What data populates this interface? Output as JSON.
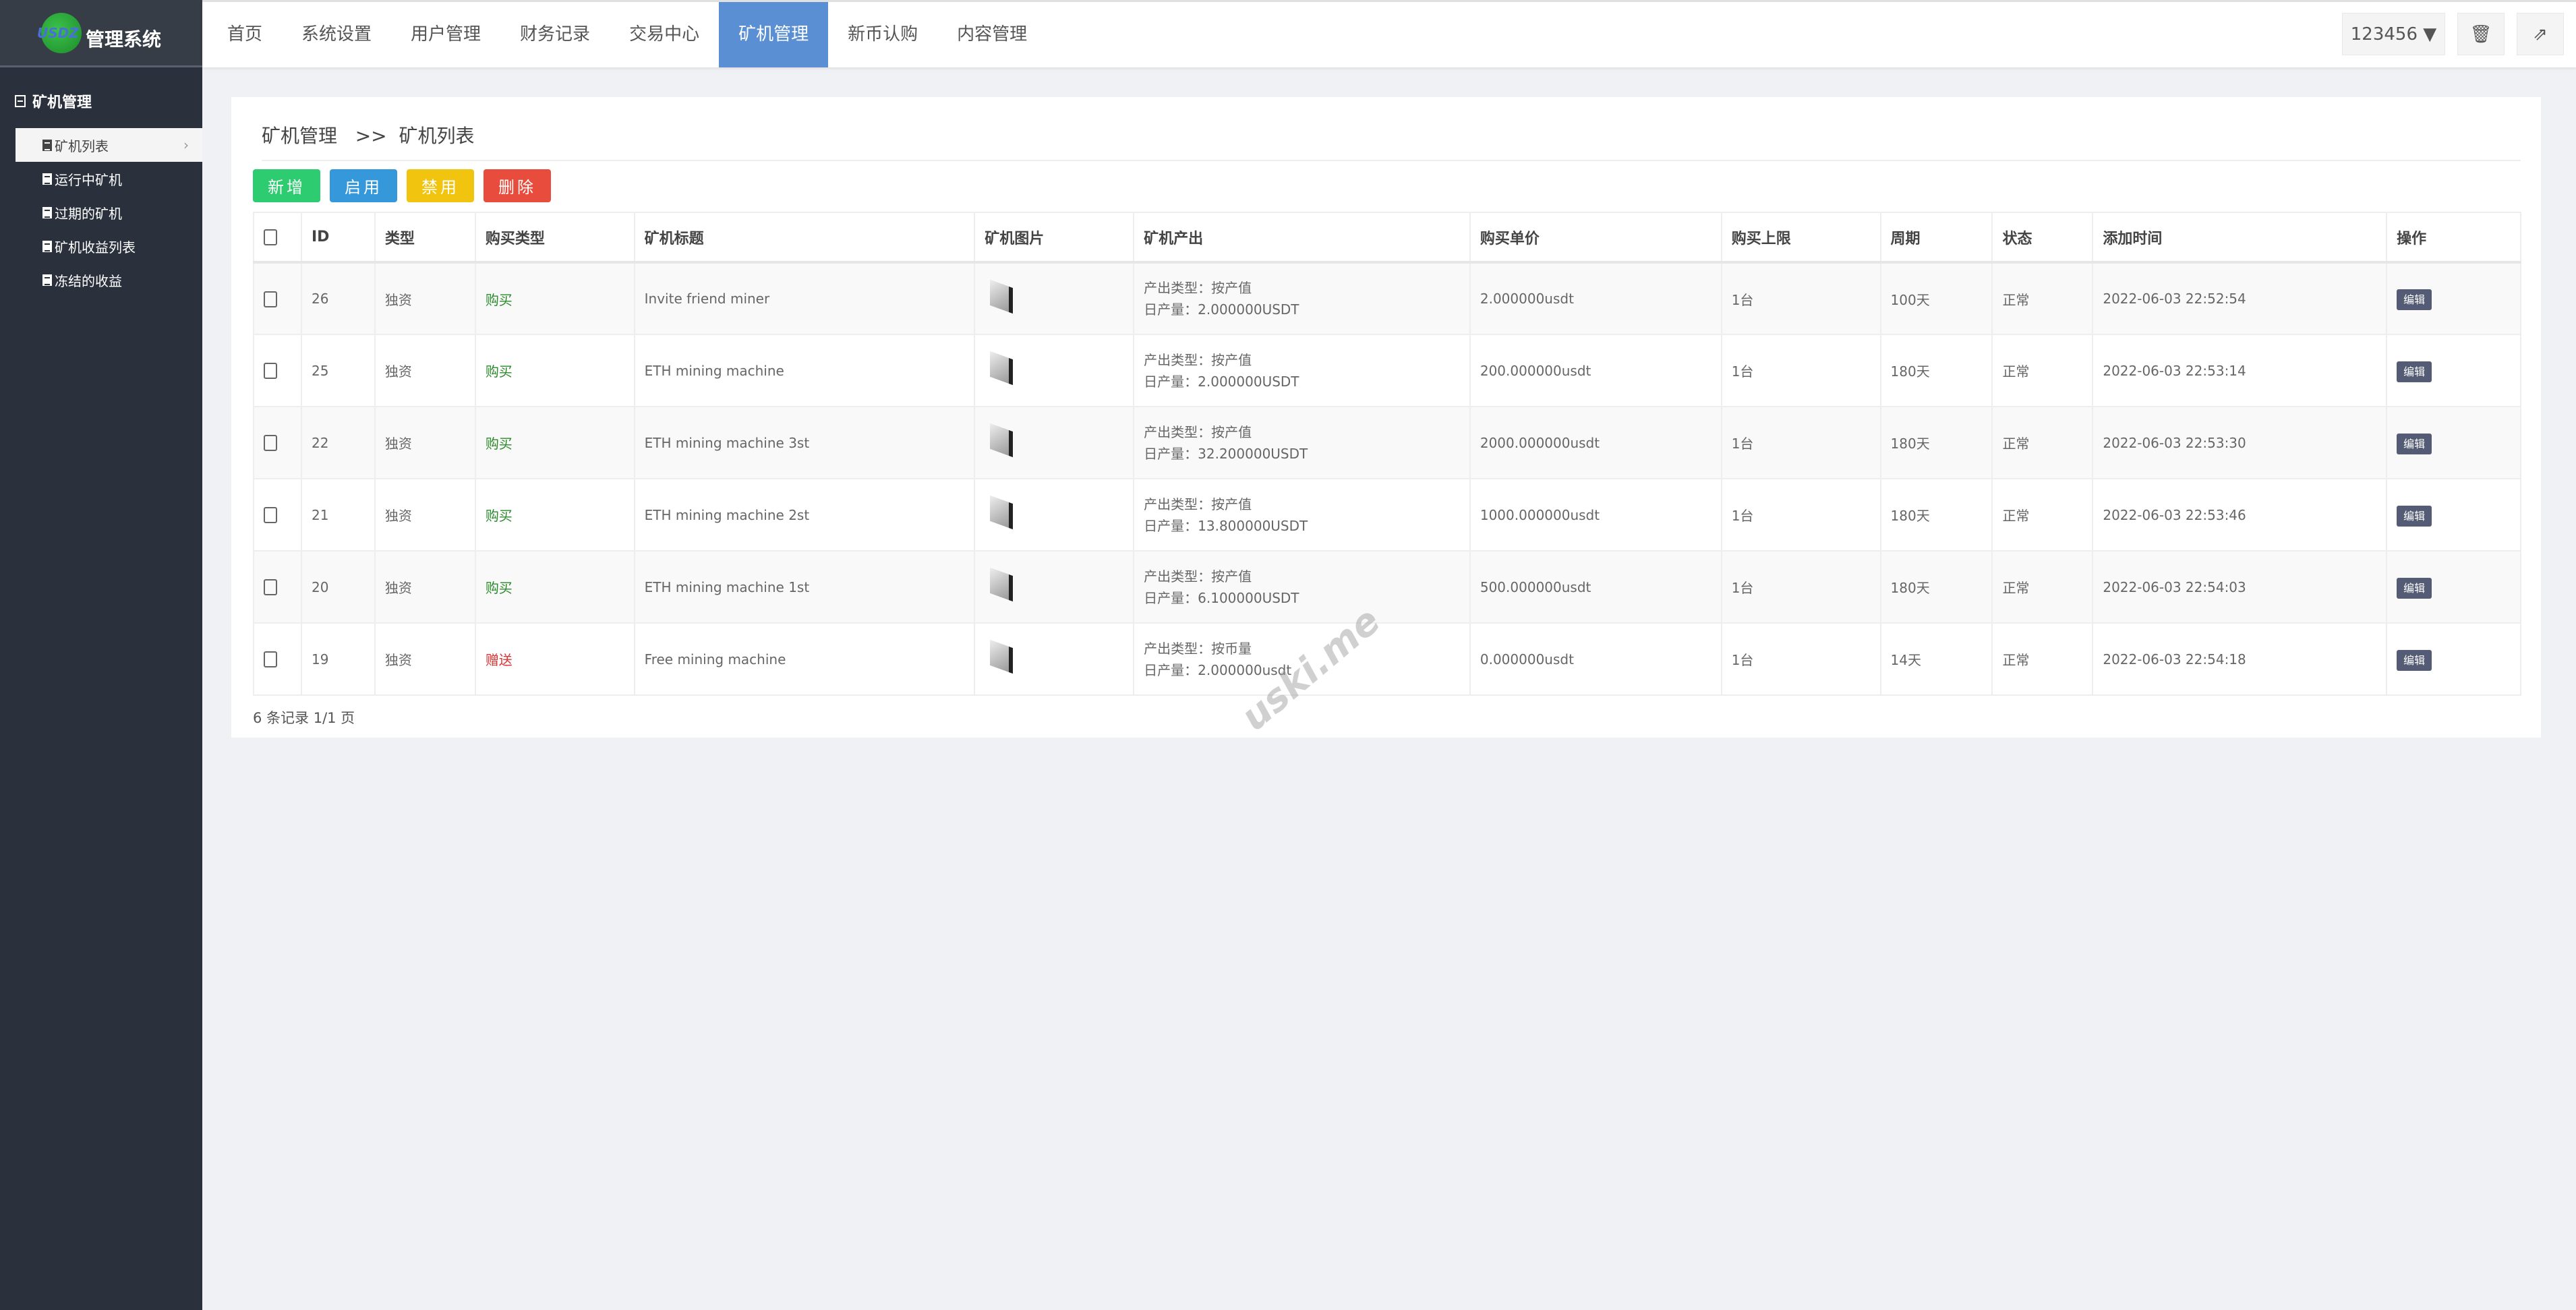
{
  "app": {
    "logo_text": "USDZ",
    "title": "管理系统"
  },
  "nav": {
    "items": [
      "首页",
      "系统设置",
      "用户管理",
      "财务记录",
      "交易中心",
      "矿机管理",
      "新币认购",
      "内容管理"
    ],
    "active": 5
  },
  "topright": {
    "user": "123456",
    "trash_icon": "trash-icon",
    "logout_icon": "share-exit-icon"
  },
  "sidebar": {
    "group": "矿机管理",
    "items": [
      "矿机列表",
      "运行中矿机",
      "过期的矿机",
      "矿机收益列表",
      "冻结的收益"
    ],
    "active": 0
  },
  "breadcrumb": {
    "parent": "矿机管理",
    "sep": ">>",
    "current": "矿机列表"
  },
  "actions": [
    {
      "label": "新增",
      "color": "#2ecc71"
    },
    {
      "label": "启用",
      "color": "#3498db"
    },
    {
      "label": "禁用",
      "color": "#f1c40f"
    },
    {
      "label": "删除",
      "color": "#e74c3c"
    }
  ],
  "table": {
    "columns": [
      "ID",
      "类型",
      "购买类型",
      "矿机标题",
      "矿机图片",
      "矿机产出",
      "购买单价",
      "购买上限",
      "周期",
      "状态",
      "添加时间",
      "操作"
    ],
    "rows": [
      {
        "id": "26",
        "type": "独资",
        "buy": "购买",
        "title": "Invite friend miner",
        "out1": "产出类型：按产值",
        "out2": "日产量：2.000000USDT",
        "price": "2.000000usdt",
        "limit": "1台",
        "period": "100天",
        "status": "正常",
        "time": "2022-06-03 22:52:54",
        "op": "编辑"
      },
      {
        "id": "25",
        "type": "独资",
        "buy": "购买",
        "title": "ETH mining machine",
        "out1": "产出类型：按产值",
        "out2": "日产量：2.000000USDT",
        "price": "200.000000usdt",
        "limit": "1台",
        "period": "180天",
        "status": "正常",
        "time": "2022-06-03 22:53:14",
        "op": "编辑"
      },
      {
        "id": "22",
        "type": "独资",
        "buy": "购买",
        "title": "ETH mining machine 3st",
        "out1": "产出类型：按产值",
        "out2": "日产量：32.200000USDT",
        "price": "2000.000000usdt",
        "limit": "1台",
        "period": "180天",
        "status": "正常",
        "time": "2022-06-03 22:53:30",
        "op": "编辑"
      },
      {
        "id": "21",
        "type": "独资",
        "buy": "购买",
        "title": "ETH mining machine 2st",
        "out1": "产出类型：按产值",
        "out2": "日产量：13.800000USDT",
        "price": "1000.000000usdt",
        "limit": "1台",
        "period": "180天",
        "status": "正常",
        "time": "2022-06-03 22:53:46",
        "op": "编辑"
      },
      {
        "id": "20",
        "type": "独资",
        "buy": "购买",
        "title": "ETH mining machine 1st",
        "out1": "产出类型：按产值",
        "out2": "日产量：6.100000USDT",
        "price": "500.000000usdt",
        "limit": "1台",
        "period": "180天",
        "status": "正常",
        "time": "2022-06-03 22:54:03",
        "op": "编辑"
      },
      {
        "id": "19",
        "type": "独资",
        "buy": "赠送",
        "title": "Free mining machine",
        "out1": "产出类型：按币量",
        "out2": "日产量：2.000000usdt",
        "price": "0.000000usdt",
        "limit": "1台",
        "period": "14天",
        "status": "正常",
        "time": "2022-06-03 22:54:18",
        "op": "编辑"
      }
    ]
  },
  "footer": "6 条记录 1/1 页",
  "watermark": "uski.me"
}
